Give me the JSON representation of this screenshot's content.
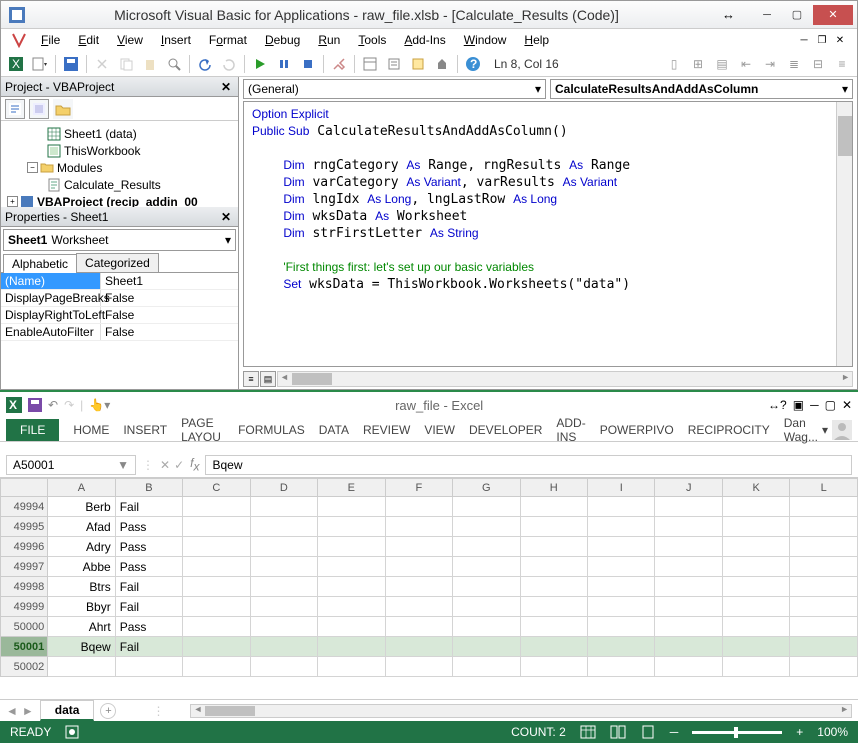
{
  "vbe": {
    "title": "Microsoft Visual Basic for Applications - raw_file.xlsb - [Calculate_Results (Code)]",
    "menu": {
      "file": "File",
      "edit": "Edit",
      "view": "View",
      "insert": "Insert",
      "format": "Format",
      "debug": "Debug",
      "run": "Run",
      "tools": "Tools",
      "addins": "Add-Ins",
      "window": "Window",
      "help": "Help"
    },
    "cursor": "Ln 8, Col 16",
    "project": {
      "title": "Project - VBAProject",
      "items": {
        "sheet1": "Sheet1 (data)",
        "thiswb": "ThisWorkbook",
        "modules": "Modules",
        "calcres": "Calculate_Results",
        "recip": "VBAProject (recip_addin_00"
      }
    },
    "props": {
      "title": "Properties - Sheet1",
      "obj_name": "Sheet1",
      "obj_type": "Worksheet",
      "tabs": {
        "alpha": "Alphabetic",
        "cat": "Categorized"
      },
      "rows": [
        {
          "name": "(Name)",
          "val": "Sheet1",
          "sel": true
        },
        {
          "name": "DisplayPageBreaks",
          "val": "False"
        },
        {
          "name": "DisplayRightToLeft",
          "val": "False"
        },
        {
          "name": "EnableAutoFilter",
          "val": "False"
        }
      ]
    },
    "code": {
      "dd1": "(General)",
      "dd2": "CalculateResultsAndAddAsColumn"
    }
  },
  "excel": {
    "title": "raw_file - Excel",
    "user": "Dan Wag...",
    "ribbon": {
      "file": "FILE",
      "home": "HOME",
      "insert": "INSERT",
      "pagelayout": "PAGE LAYOU",
      "formulas": "FORMULAS",
      "data": "DATA",
      "review": "REVIEW",
      "view": "VIEW",
      "developer": "DEVELOPER",
      "addins": "ADD-INS",
      "powerpivo": "POWERPIVO",
      "reciprocity": "RECIPROCITY"
    },
    "namebox": "A50001",
    "fx_value": "Bqew",
    "cols": [
      "A",
      "B",
      "C",
      "D",
      "E",
      "F",
      "G",
      "H",
      "I",
      "J",
      "K",
      "L"
    ],
    "rows": [
      {
        "r": "49994",
        "a": "Berb",
        "b": "Fail"
      },
      {
        "r": "49995",
        "a": "Afad",
        "b": "Pass"
      },
      {
        "r": "49996",
        "a": "Adry",
        "b": "Pass"
      },
      {
        "r": "49997",
        "a": "Abbe",
        "b": "Pass"
      },
      {
        "r": "49998",
        "a": "Btrs",
        "b": "Fail"
      },
      {
        "r": "49999",
        "a": "Bbyr",
        "b": "Fail"
      },
      {
        "r": "50000",
        "a": "Ahrt",
        "b": "Pass"
      },
      {
        "r": "50001",
        "a": "Bqew",
        "b": "Fail",
        "sel": true
      },
      {
        "r": "50002",
        "a": "",
        "b": ""
      }
    ],
    "sheet_tab": "data",
    "status": {
      "ready": "READY",
      "count": "COUNT: 2",
      "zoom": "100%"
    }
  }
}
